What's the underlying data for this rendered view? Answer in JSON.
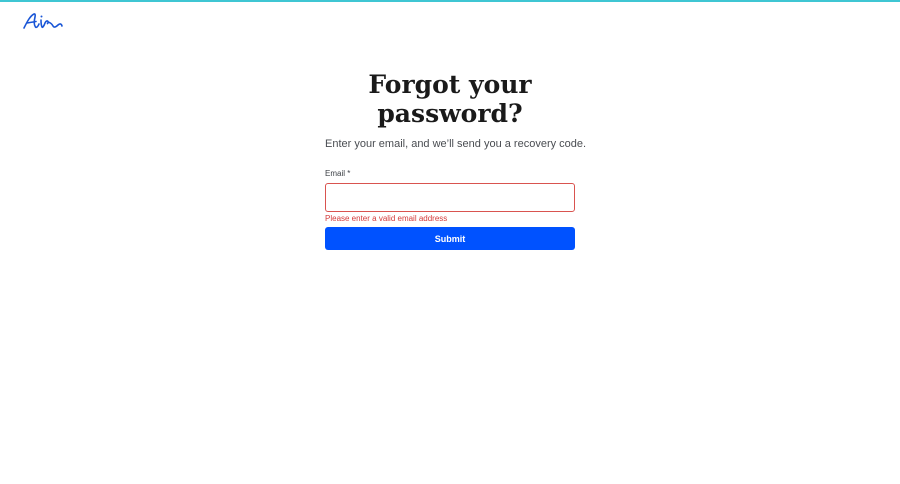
{
  "brand": {
    "logo_icon": "air-script-logo-icon",
    "accent_color": "#3fc6d3",
    "logo_color": "#1a56d6"
  },
  "form": {
    "title": "Forgot your password?",
    "subtitle": "Enter your email, and we’ll send you a recovery code.",
    "email_label": "Email *",
    "email_value": "",
    "email_placeholder": "",
    "error_message": "Please enter a valid email address",
    "error_color": "#d33a3a",
    "submit_label": "Submit",
    "submit_color": "#0052ff"
  }
}
